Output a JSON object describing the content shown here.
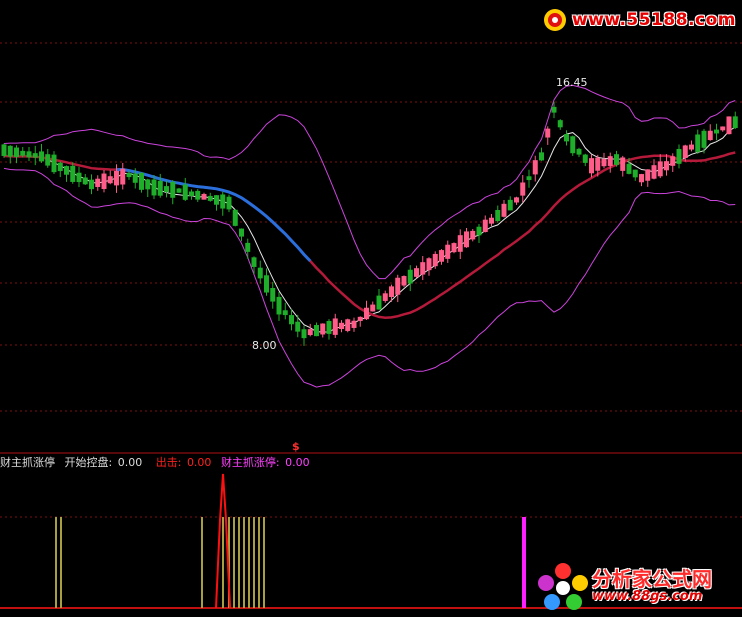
{
  "chart_data": {
    "type": "candlestick",
    "main_panel": {
      "annotations": {
        "high_label": "16.45",
        "low_label": "8.00",
        "marker_symbol": "$"
      },
      "colors": {
        "up": "#ff5c8a",
        "down": "#1fae2a",
        "ma_fast": "#e6e6e6",
        "ma_mid_rising": "#b51a3a",
        "ma_mid_falling": "#2a6fdc",
        "band": "#cc44dd",
        "grid": "#7a1010"
      }
    },
    "indicator_panel": {
      "legend": [
        {
          "label": "财主抓涨停",
          "value": "",
          "color": "#dcdcdc"
        },
        {
          "label": "开始控盘:",
          "value": "0.00",
          "color": "#dcdcdc"
        },
        {
          "label": "出击:",
          "value": "0.00",
          "color": "#ff2020"
        },
        {
          "label": "财主抓涨停:",
          "value": "0.00",
          "color": "#ff40ff"
        }
      ],
      "colors": {
        "bar": "#a8a040",
        "spike": "#ff1010",
        "signal": "#ff20ff",
        "base": "#c01010"
      }
    }
  },
  "watermarks": {
    "top_url": "www.55188.com",
    "bottom_name": "分析家公式网",
    "bottom_url": "www.88gs.com"
  }
}
